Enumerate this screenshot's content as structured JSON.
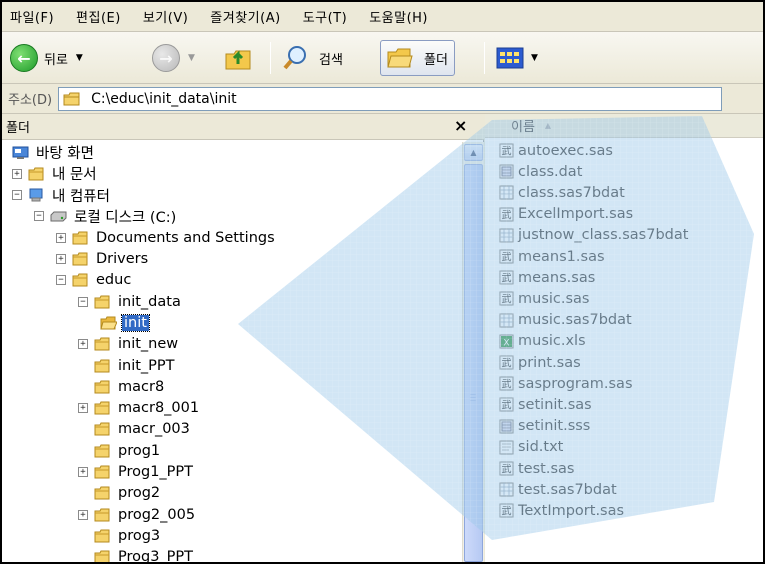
{
  "menu": [
    "파일(F)",
    "편집(E)",
    "보기(V)",
    "즐겨찾기(A)",
    "도구(T)",
    "도움말(H)"
  ],
  "toolbar": {
    "back_label": "뒤로",
    "search_label": "검색",
    "folders_label": "폴더"
  },
  "address": {
    "label": "주소(D)",
    "path": "C:\\educ\\init_data\\init"
  },
  "folder_pane": {
    "title": "폴더",
    "close": "×",
    "tree": [
      {
        "label": "바탕 화면",
        "icon": "desktop-icon",
        "expander": "none",
        "indent": 0
      },
      {
        "label": "내 문서",
        "icon": "folder-icon",
        "expander": "plus",
        "indent": 0
      },
      {
        "label": "내 컴퓨터",
        "icon": "computer-icon",
        "expander": "minus",
        "indent": 0
      },
      {
        "label": "로컬 디스크 (C:)",
        "icon": "drive-icon",
        "expander": "minus",
        "indent": 1
      },
      {
        "label": "Documents and Settings",
        "icon": "folder-icon",
        "expander": "plus",
        "indent": 2
      },
      {
        "label": "Drivers",
        "icon": "folder-icon",
        "expander": "plus",
        "indent": 2
      },
      {
        "label": "educ",
        "icon": "folder-icon",
        "expander": "minus",
        "indent": 2
      },
      {
        "label": "init_data",
        "icon": "folder-icon",
        "expander": "minus",
        "indent": 3
      },
      {
        "label": "init",
        "icon": "open-folder-icon",
        "expander": "none",
        "indent": 4,
        "selected": true
      },
      {
        "label": "init_new",
        "icon": "folder-icon",
        "expander": "plus",
        "indent": 3
      },
      {
        "label": "init_PPT",
        "icon": "folder-icon",
        "expander": "none",
        "indent": 3
      },
      {
        "label": "macr8",
        "icon": "folder-icon",
        "expander": "none",
        "indent": 3
      },
      {
        "label": "macr8_001",
        "icon": "folder-icon",
        "expander": "plus",
        "indent": 3
      },
      {
        "label": "macr_003",
        "icon": "folder-icon",
        "expander": "none",
        "indent": 3
      },
      {
        "label": "prog1",
        "icon": "folder-icon",
        "expander": "none",
        "indent": 3
      },
      {
        "label": "Prog1_PPT",
        "icon": "folder-icon",
        "expander": "plus",
        "indent": 3
      },
      {
        "label": "prog2",
        "icon": "folder-icon",
        "expander": "none",
        "indent": 3
      },
      {
        "label": "prog2_005",
        "icon": "folder-icon",
        "expander": "plus",
        "indent": 3
      },
      {
        "label": "prog3",
        "icon": "folder-icon",
        "expander": "none",
        "indent": 3
      },
      {
        "label": "Prog3_PPT",
        "icon": "folder-icon",
        "expander": "none",
        "indent": 3
      }
    ]
  },
  "file_list": {
    "column_name": "이름",
    "files": [
      {
        "name": "autoexec.sas",
        "icon": "sas-program-icon"
      },
      {
        "name": "class.dat",
        "icon": "data-file-icon"
      },
      {
        "name": "class.sas7bdat",
        "icon": "sas-dataset-icon"
      },
      {
        "name": "ExcelImport.sas",
        "icon": "sas-program-icon"
      },
      {
        "name": "justnow_class.sas7bdat",
        "icon": "sas-dataset-icon"
      },
      {
        "name": "means1.sas",
        "icon": "sas-program-icon"
      },
      {
        "name": "means.sas",
        "icon": "sas-program-icon"
      },
      {
        "name": "music.sas",
        "icon": "sas-program-icon"
      },
      {
        "name": "music.sas7bdat",
        "icon": "sas-dataset-icon"
      },
      {
        "name": "music.xls",
        "icon": "excel-file-icon"
      },
      {
        "name": "print.sas",
        "icon": "sas-program-icon"
      },
      {
        "name": "sasprogram.sas",
        "icon": "sas-program-icon"
      },
      {
        "name": "setinit.sas",
        "icon": "sas-program-icon"
      },
      {
        "name": "setinit.sss",
        "icon": "data-file-icon"
      },
      {
        "name": "sid.txt",
        "icon": "text-file-icon"
      },
      {
        "name": "test.sas",
        "icon": "sas-program-icon"
      },
      {
        "name": "test.sas7bdat",
        "icon": "sas-dataset-icon"
      },
      {
        "name": "TextImport.sas",
        "icon": "sas-program-icon"
      }
    ]
  },
  "colors": {
    "selection": "#316ac5",
    "highlight_overlay": "#9cc8e8",
    "folder_yellow": "#f5d36b"
  }
}
